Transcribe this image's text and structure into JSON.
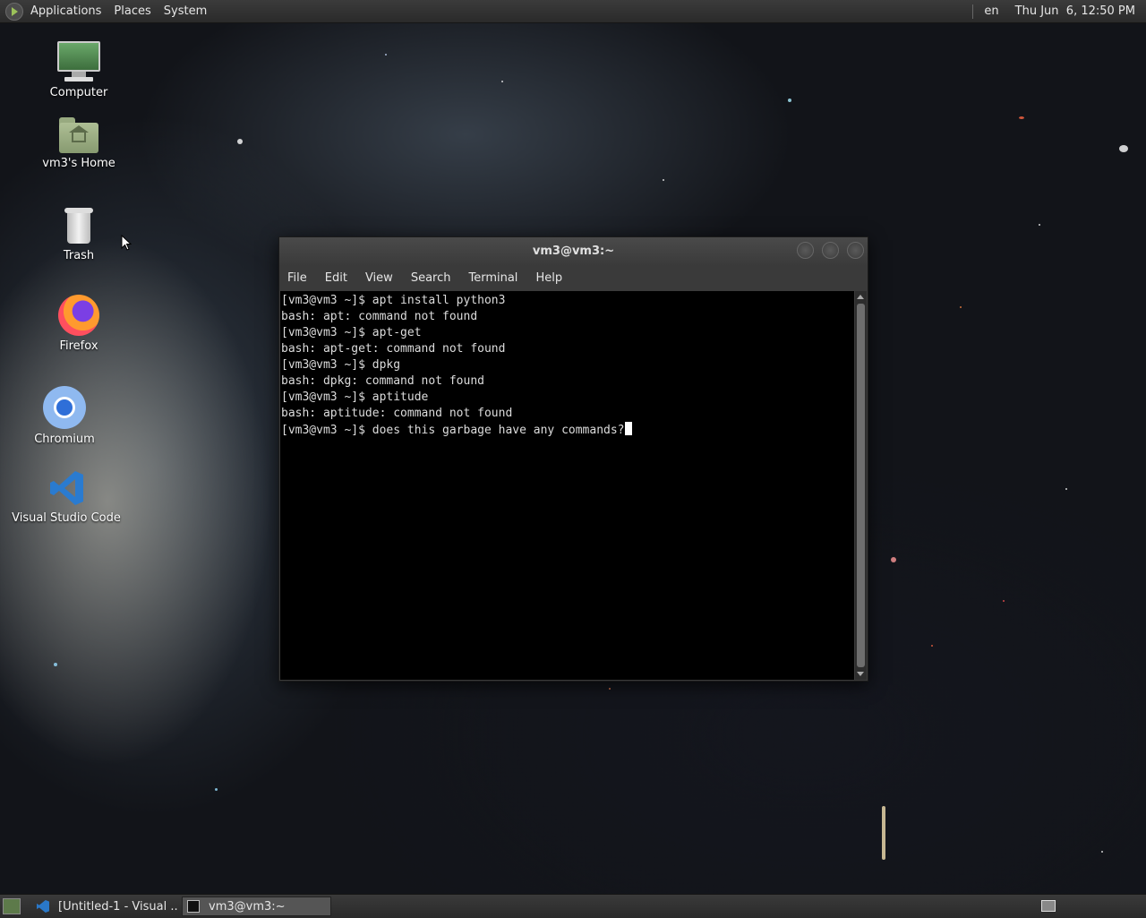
{
  "top_panel": {
    "menu": [
      "Applications",
      "Places",
      "System"
    ],
    "language": "en",
    "clock": "Thu Jun  6, 12:50 PM",
    "app_icon": "gnome-foot-icon"
  },
  "desktop_icons": [
    {
      "label": "Computer",
      "icon": "computer-icon"
    },
    {
      "label": "vm3's Home",
      "icon": "home-folder-icon"
    },
    {
      "label": "Trash",
      "icon": "trash-icon"
    },
    {
      "label": "Firefox",
      "icon": "firefox-icon"
    },
    {
      "label": "Chromium",
      "icon": "chromium-icon"
    },
    {
      "label": "Visual Studio Code",
      "icon": "vscode-icon"
    }
  ],
  "terminal": {
    "title": "vm3@vm3:~",
    "menu": [
      "File",
      "Edit",
      "View",
      "Search",
      "Terminal",
      "Help"
    ],
    "lines": [
      "[vm3@vm3 ~]$ apt install python3",
      "bash: apt: command not found",
      "[vm3@vm3 ~]$ apt-get",
      "bash: apt-get: command not found",
      "[vm3@vm3 ~]$ dpkg",
      "bash: dpkg: command not found",
      "[vm3@vm3 ~]$ aptitude",
      "bash: aptitude: command not found",
      "[vm3@vm3 ~]$ does this garbage have any commands?"
    ]
  },
  "taskbar": {
    "tasks": [
      {
        "label": "[Untitled-1 - Visual ...",
        "icon": "vscode-icon"
      },
      {
        "label": "vm3@vm3:~",
        "icon": "terminal-icon"
      }
    ]
  }
}
